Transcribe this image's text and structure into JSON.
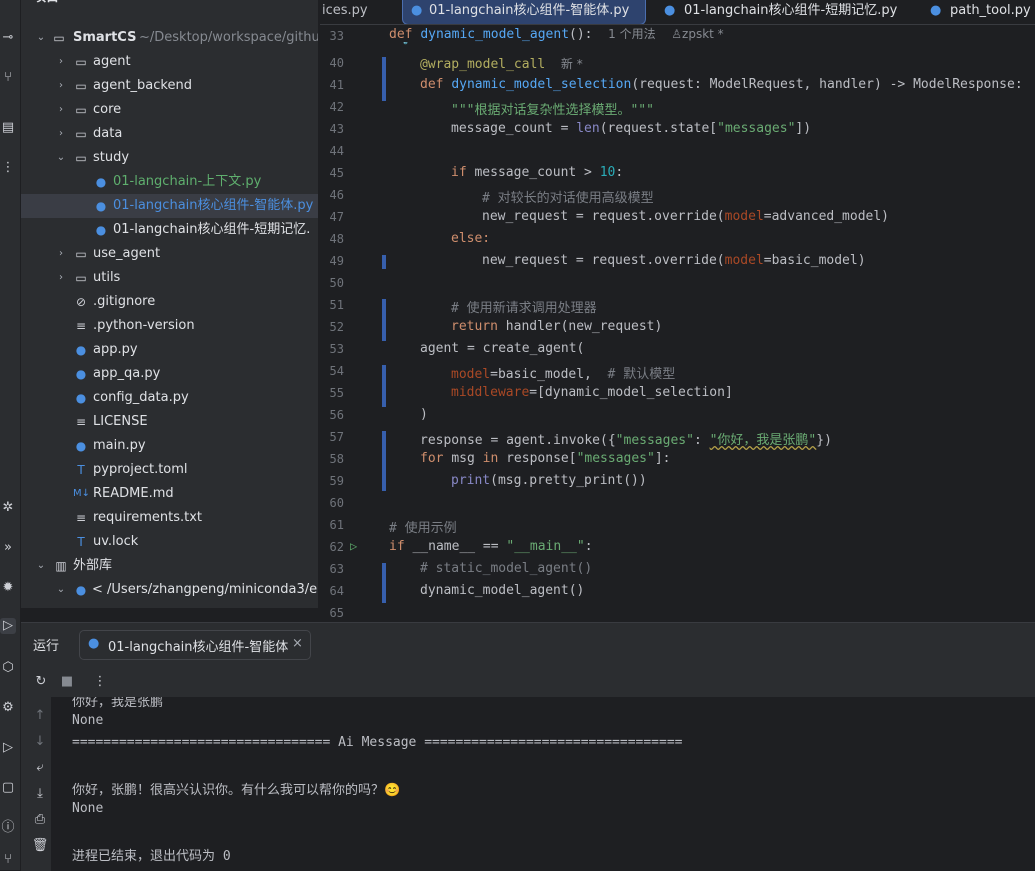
{
  "project_panel": {
    "title": "项目",
    "root": {
      "name": "SmartCS",
      "path": "~/Desktop/workspace/githu"
    },
    "items": [
      {
        "label": "agent",
        "type": "folder"
      },
      {
        "label": "agent_backend",
        "type": "folder"
      },
      {
        "label": "core",
        "type": "folder"
      },
      {
        "label": "data",
        "type": "folder"
      },
      {
        "label": "study",
        "type": "folder"
      },
      {
        "label": "01-langchain-上下文.py",
        "type": "py"
      },
      {
        "label": "01-langchain核心组件-智能体.py",
        "type": "py"
      },
      {
        "label": "01-langchain核心组件-短期记忆.",
        "type": "py"
      },
      {
        "label": "use_agent",
        "type": "folder"
      },
      {
        "label": "utils",
        "type": "folder"
      },
      {
        "label": ".gitignore",
        "type": "ignore"
      },
      {
        "label": ".python-version",
        "type": "text"
      },
      {
        "label": "app.py",
        "type": "py"
      },
      {
        "label": "app_qa.py",
        "type": "py"
      },
      {
        "label": "config_data.py",
        "type": "py"
      },
      {
        "label": "LICENSE",
        "type": "text"
      },
      {
        "label": "main.py",
        "type": "py"
      },
      {
        "label": "pyproject.toml",
        "type": "toml"
      },
      {
        "label": "README.md",
        "type": "md"
      },
      {
        "label": "requirements.txt",
        "type": "text"
      },
      {
        "label": "uv.lock",
        "type": "toml"
      }
    ],
    "external": "外部库",
    "external_child": "< /Users/zhangpeng/miniconda3/e"
  },
  "editor_tabs": [
    {
      "label": "ices.py"
    },
    {
      "label": "01-langchain核心组件-智能体.py"
    },
    {
      "label": "01-langchain核心组件-短期记忆.py"
    },
    {
      "label": "path_tool.py"
    }
  ],
  "editor": {
    "line_numbers": [
      "33",
      "40",
      "41",
      "42",
      "43",
      "44",
      "45",
      "46",
      "47",
      "48",
      "49",
      "50",
      "51",
      "52",
      "53",
      "54",
      "55",
      "56",
      "57",
      "58",
      "59",
      "60",
      "61",
      "62",
      "63",
      "64",
      "65"
    ],
    "sticky_def": "def",
    "sticky_name": "dynamic_model_agent",
    "sticky_paren": "():",
    "sticky_usages": "1 个用法",
    "sticky_author": "zpskt *",
    "l40_decorator": "@wrap_model_call",
    "l40_hint": "新 *",
    "l41_def": "def ",
    "l41_name": "dynamic_model_selection",
    "l41_rest": "(request: ModelRequest, handler) -> ModelResponse:",
    "l42": "\"\"\"根据对话复杂性选择模型。\"\"\"",
    "l43_a": "message_count = ",
    "l43_b": "len",
    "l43_c": "(request.state[",
    "l43_d": "\"messages\"",
    "l43_e": "])",
    "l45_kw": "if ",
    "l45_a": "message_count > ",
    "l45_num": "10",
    "l45_b": ":",
    "l46": "# 对较长的对话使用高级模型",
    "l47_a": "new_request = request.override(",
    "l47_p": "model",
    "l47_b": "=advanced_model)",
    "l48": "else:",
    "l49_a": "new_request = request.override(",
    "l49_p": "model",
    "l49_b": "=basic_model)",
    "l51": "# 使用新请求调用处理器",
    "l52_kw": "return ",
    "l52_a": "handler(new_request)",
    "l53": "agent = create_agent(",
    "l54_p": "model",
    "l54_a": "=basic_model,  ",
    "l54_c": "# 默认模型",
    "l55_p": "middleware",
    "l55_a": "=[dynamic_model_selection]",
    "l56": ")",
    "l57_a": "response = agent.invoke({",
    "l57_s1": "\"messages\"",
    "l57_b": ": ",
    "l57_s2": "\"你好，我是张鹏\"",
    "l57_c": "})",
    "l58_kw1": "for ",
    "l58_a": "msg ",
    "l58_kw2": "in ",
    "l58_b": "response[",
    "l58_s": "\"messages\"",
    "l58_c": "]:",
    "l59_bi": "print",
    "l59_a": "(msg.pretty_print())",
    "l61": "# 使用示例",
    "l62_kw": "if ",
    "l62_a": "__name__ == ",
    "l62_s": "\"__main__\"",
    "l62_b": ":",
    "l63": "# static_model_agent()",
    "l64": "dynamic_model_agent()"
  },
  "run_panel": {
    "title": "运行",
    "tab_label": "01-langchain核心组件-智能体",
    "console": [
      "你好，我是张鹏",
      "None",
      "================================= Ai Message =================================",
      "",
      "你好，张鹏！很高兴认识你。有什么我可以帮你的吗？😊",
      "None",
      "",
      "进程已结束，退出代码为 0"
    ]
  }
}
